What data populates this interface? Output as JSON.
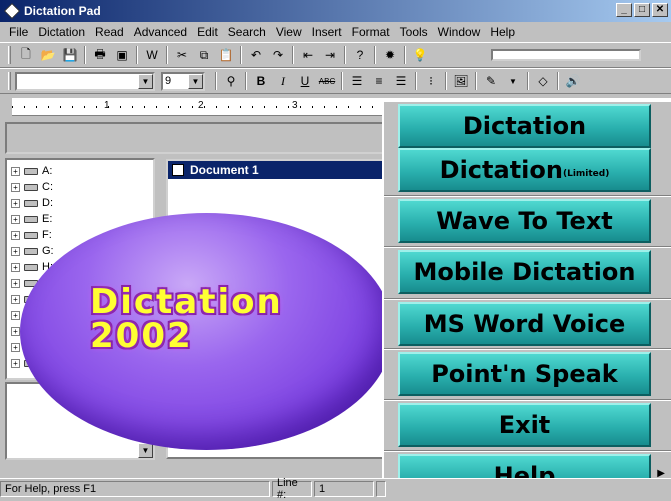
{
  "window": {
    "title": "Dictation Pad",
    "min": "_",
    "max": "□",
    "close": "✕"
  },
  "menu": [
    "File",
    "Dictation",
    "Read",
    "Advanced",
    "Edit",
    "Search",
    "View",
    "Insert",
    "Format",
    "Tools",
    "Window",
    "Help"
  ],
  "toolbar": {
    "progress": 0
  },
  "format": {
    "font_value": "",
    "size_value": "9"
  },
  "ruler": [
    "1",
    "2",
    "3"
  ],
  "drives": [
    "A:",
    "C:",
    "D:",
    "E:",
    "F:",
    "G:",
    "H:",
    "",
    "",
    "",
    "",
    "",
    "",
    ""
  ],
  "document": {
    "title": "Document 1"
  },
  "logo": {
    "line1": "Dictation",
    "line2": "2002"
  },
  "launcher": {
    "buttons": [
      {
        "label": "Dictation",
        "suffix": ""
      },
      {
        "label": "Dictation",
        "suffix": "(Limited)"
      },
      {
        "label": "Wave To Text",
        "suffix": ""
      },
      {
        "label": "Mobile Dictation",
        "suffix": ""
      },
      {
        "label": "MS Word Voice",
        "suffix": ""
      },
      {
        "label": "Point'n Speak",
        "suffix": ""
      },
      {
        "label": "Exit",
        "suffix": ""
      },
      {
        "label": "Help",
        "suffix": ""
      }
    ]
  },
  "status": {
    "help": "For Help, press F1",
    "line_label": "Line #:",
    "line_value": "1"
  }
}
